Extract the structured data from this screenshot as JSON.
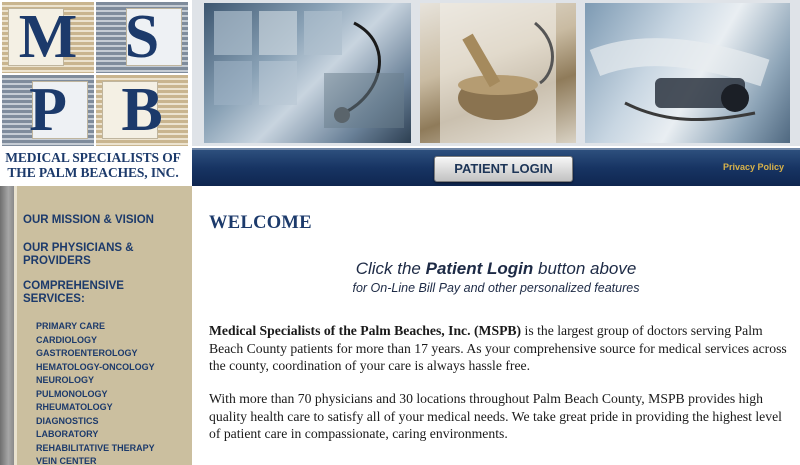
{
  "logo": {
    "letters": [
      "M",
      "S",
      "P",
      "B"
    ],
    "name_line1": "MEDICAL SPECIALISTS OF",
    "name_line2": "THE PALM BEACHES, INC."
  },
  "navbar": {
    "login_label": "PATIENT LOGIN",
    "privacy_label": "Privacy Policy"
  },
  "sidebar": {
    "mission": "OUR MISSION & VISION",
    "physicians": "OUR PHYSICIANS & PROVIDERS",
    "services": "COMPREHENSIVE SERVICES:",
    "service_items": [
      "PRIMARY CARE",
      "CARDIOLOGY",
      "GASTROENTEROLOGY",
      "HEMATOLOGY-ONCOLOGY",
      "NEUROLOGY",
      "PULMONOLOGY",
      "RHEUMATOLOGY",
      "DIAGNOSTICS",
      "LABORATORY",
      "REHABILITATIVE THERAPY",
      "VEIN CENTER"
    ]
  },
  "main": {
    "welcome": "WELCOME",
    "promo_click": "Click the ",
    "promo_bold": "Patient Login",
    "promo_rest": " button above",
    "promo_line2": "for On-Line Bill Pay and other personalized features",
    "para1_bold": "Medical Specialists of the Palm Beaches, Inc. (MSPB)",
    "para1_rest": " is the largest group of doctors serving Palm Beach County patients for more than 17 years. As your comprehensive source for medical services across the county, coordination of your care is always hassle free.",
    "para2": "With more than 70 physicians and 30 locations throughout Palm Beach County, MSPB provides high quality health care to satisfy all of your medical needs.  We take great pride in providing the highest level of patient care in compassionate, caring environments."
  },
  "colors": {
    "navy": "#1c3a6b",
    "sidebar_bg": "#cbbf9f",
    "privacy_gold": "#d8b24a"
  }
}
